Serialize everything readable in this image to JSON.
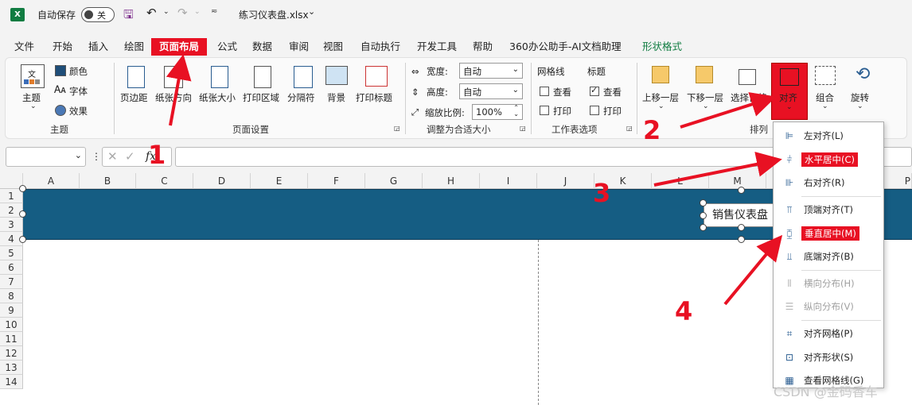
{
  "titlebar": {
    "autosave": "自动保存",
    "toggle": "关",
    "filename": "练习仪表盘.xlsx",
    "filename_caret": "⌄"
  },
  "menu": {
    "tabs": [
      "文件",
      "开始",
      "插入",
      "绘图",
      "页面布局",
      "公式",
      "数据",
      "审阅",
      "视图",
      "自动执行",
      "开发工具",
      "帮助",
      "360办公助手-AI文档助理",
      "形状格式"
    ]
  },
  "ribbon": {
    "theme": {
      "themes": "主题",
      "colors": "颜色",
      "fonts": "字体",
      "effects": "效果",
      "group": "主题"
    },
    "page_setup": {
      "margins": "页边距",
      "orientation": "纸张方向",
      "size": "纸张大小",
      "print_area": "打印区域",
      "breaks": "分隔符",
      "background": "背景",
      "print_titles": "打印标题",
      "group": "页面设置"
    },
    "scale": {
      "width_label": "宽度:",
      "width_value": "自动",
      "height_label": "高度:",
      "height_value": "自动",
      "scale_label": "缩放比例:",
      "scale_value": "100%",
      "group": "调整为合适大小"
    },
    "sheet_options": {
      "gridlines": "网格线",
      "headings": "标题",
      "view": "查看",
      "print": "打印",
      "group": "工作表选项"
    },
    "arrange": {
      "bring_forward": "上移一层",
      "send_backward": "下移一层",
      "selection_pane": "选择窗格",
      "align": "对齐",
      "group_btn": "组合",
      "rotate": "旋转",
      "group": "排列"
    }
  },
  "formula": {
    "fx": "fx"
  },
  "grid": {
    "columns": [
      "A",
      "B",
      "C",
      "D",
      "E",
      "F",
      "G",
      "H",
      "I",
      "J",
      "K",
      "L",
      "M",
      "P"
    ],
    "rows": [
      "1",
      "2",
      "3",
      "4",
      "5",
      "6",
      "7",
      "8",
      "9",
      "10",
      "11",
      "12",
      "13",
      "14"
    ],
    "textbox": "销售仪表盘"
  },
  "align_menu": {
    "items": [
      {
        "label": "左对齐(L)",
        "icon": "align-left-icon",
        "highlight": false,
        "disabled": false
      },
      {
        "label": "水平居中(C)",
        "icon": "align-center-icon",
        "highlight": true,
        "disabled": false
      },
      {
        "label": "右对齐(R)",
        "icon": "align-right-icon",
        "highlight": false,
        "disabled": false
      },
      {
        "label": "顶端对齐(T)",
        "icon": "align-top-icon",
        "highlight": false,
        "disabled": false
      },
      {
        "label": "垂直居中(M)",
        "icon": "align-middle-icon",
        "highlight": true,
        "disabled": false
      },
      {
        "label": "底端对齐(B)",
        "icon": "align-bottom-icon",
        "highlight": false,
        "disabled": false
      },
      {
        "label": "横向分布(H)",
        "icon": "distribute-horizontal-icon",
        "highlight": false,
        "disabled": true
      },
      {
        "label": "纵向分布(V)",
        "icon": "distribute-vertical-icon",
        "highlight": false,
        "disabled": true
      },
      {
        "label": "对齐网格(P)",
        "icon": "snap-grid-icon",
        "highlight": false,
        "disabled": false
      },
      {
        "label": "对齐形状(S)",
        "icon": "snap-shape-icon",
        "highlight": false,
        "disabled": false
      },
      {
        "label": "查看网格线(G)",
        "icon": "view-gridlines-icon",
        "highlight": false,
        "disabled": false
      }
    ]
  },
  "annotations": [
    "1",
    "2",
    "3",
    "4"
  ],
  "watermark": "CSDN @金码香车",
  "colors": {
    "accent_red": "#e81123",
    "banner": "#155d83",
    "excel_green": "#107c41"
  }
}
